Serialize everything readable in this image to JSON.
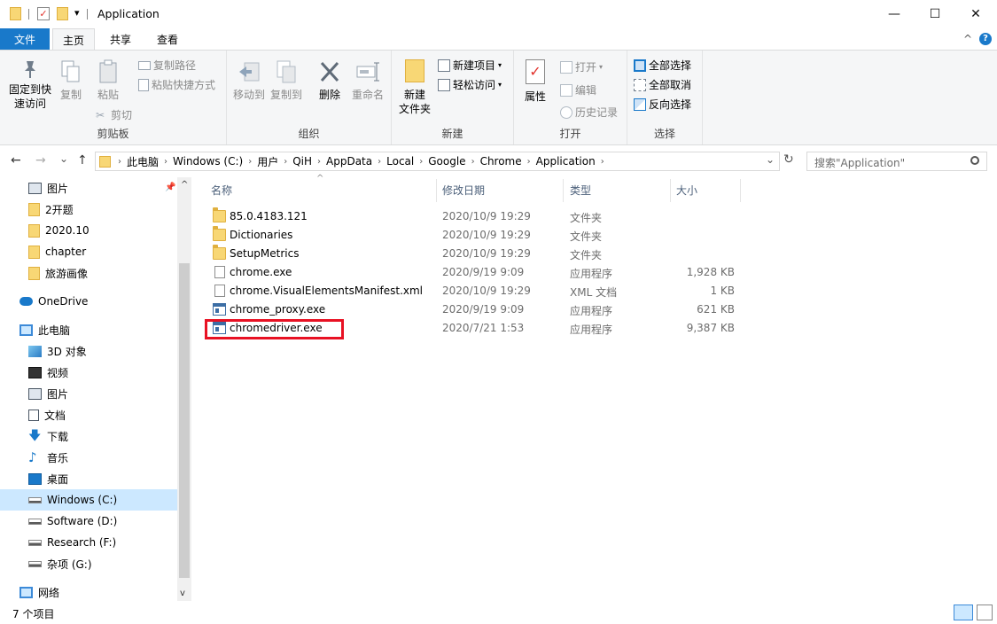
{
  "titlebar": {
    "title": "Application",
    "qat_dropdown": "▾",
    "minimize": "—",
    "maximize": "☐",
    "close": "✕"
  },
  "tabs": {
    "file": "文件",
    "home": "主页",
    "share": "共享",
    "view": "查看",
    "collapse": "^",
    "help": "?"
  },
  "ribbon": {
    "clipboard": {
      "label": "剪贴板",
      "pin_line1": "固定到快",
      "pin_line2": "速访问",
      "copy": "复制",
      "paste": "粘贴",
      "copy_path": "复制路径",
      "paste_shortcut": "粘贴快捷方式",
      "cut": "剪切"
    },
    "organize": {
      "label": "组织",
      "move_to": "移动到",
      "copy_to": "复制到",
      "delete": "删除",
      "rename": "重命名"
    },
    "new": {
      "label": "新建",
      "new_folder_line1": "新建",
      "new_folder_line2": "文件夹",
      "new_item": "新建项目",
      "easy_access": "轻松访问"
    },
    "open": {
      "label": "打开",
      "properties": "属性",
      "open": "打开",
      "edit": "编辑",
      "history": "历史记录"
    },
    "select": {
      "label": "选择",
      "select_all": "全部选择",
      "select_none": "全部取消",
      "invert": "反向选择"
    }
  },
  "address": {
    "back": "←",
    "forward": "→",
    "recent": "⌄",
    "up": "↑",
    "breadcrumb": [
      "此电脑",
      "Windows  (C:)",
      "用户",
      "QiH",
      "AppData",
      "Local",
      "Google",
      "Chrome",
      "Application"
    ],
    "dropdown": "⌄",
    "refresh": "↻",
    "search_placeholder": "搜索\"Application\""
  },
  "nav": {
    "items": [
      {
        "label": "图片",
        "icon": "pictures-icon"
      },
      {
        "label": "2开题",
        "icon": "folder-icon"
      },
      {
        "label": "2020.10",
        "icon": "folder-icon"
      },
      {
        "label": "chapter",
        "icon": "folder-icon"
      },
      {
        "label": "旅游画像",
        "icon": "folder-icon"
      },
      {
        "label": "OneDrive",
        "icon": "cloud-icon"
      },
      {
        "label": "此电脑",
        "icon": "computer-icon"
      },
      {
        "label": "3D 对象",
        "icon": "cube-icon"
      },
      {
        "label": "视频",
        "icon": "video-icon"
      },
      {
        "label": "图片",
        "icon": "pictures-icon"
      },
      {
        "label": "文档",
        "icon": "documents-icon"
      },
      {
        "label": "下载",
        "icon": "download-icon"
      },
      {
        "label": "音乐",
        "icon": "music-icon"
      },
      {
        "label": "桌面",
        "icon": "desktop-icon"
      },
      {
        "label": "Windows  (C:)",
        "icon": "drive-icon"
      },
      {
        "label": "Software (D:)",
        "icon": "drive-icon"
      },
      {
        "label": "Research (F:)",
        "icon": "drive-icon"
      },
      {
        "label": "杂项 (G:)",
        "icon": "drive-icon"
      },
      {
        "label": "网络",
        "icon": "network-icon"
      }
    ]
  },
  "filelist": {
    "columns": {
      "name": "名称",
      "date": "修改日期",
      "type": "类型",
      "size": "大小"
    },
    "rows": [
      {
        "name": "85.0.4183.121",
        "date": "2020/10/9 19:29",
        "type": "文件夹",
        "size": "",
        "icon": "folder-icon"
      },
      {
        "name": "Dictionaries",
        "date": "2020/10/9 19:29",
        "type": "文件夹",
        "size": "",
        "icon": "folder-icon"
      },
      {
        "name": "SetupMetrics",
        "date": "2020/10/9 19:29",
        "type": "文件夹",
        "size": "",
        "icon": "folder-icon"
      },
      {
        "name": "chrome.exe",
        "date": "2020/9/19 9:09",
        "type": "应用程序",
        "size": "1,928 KB",
        "icon": "chrome-icon"
      },
      {
        "name": "chrome.VisualElementsManifest.xml",
        "date": "2020/10/9 19:29",
        "type": "XML 文档",
        "size": "1 KB",
        "icon": "xml-file-icon"
      },
      {
        "name": "chrome_proxy.exe",
        "date": "2020/9/19 9:09",
        "type": "应用程序",
        "size": "621 KB",
        "icon": "exe-icon"
      },
      {
        "name": "chromedriver.exe",
        "date": "2020/7/21 1:53",
        "type": "应用程序",
        "size": "9,387 KB",
        "icon": "exe-icon"
      }
    ]
  },
  "status": {
    "count": "7 个项目"
  },
  "colors": {
    "file_tab": "#1979ca",
    "selected_nav": "#cce8ff",
    "highlight_box": "#e81123"
  }
}
